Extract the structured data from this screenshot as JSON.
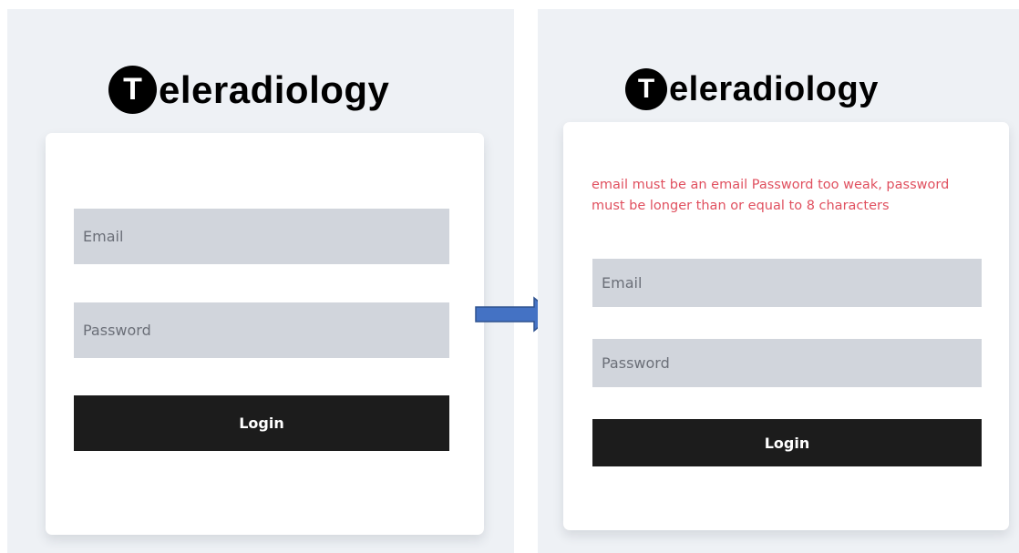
{
  "brand": {
    "initial": "T",
    "name": "eleradiology"
  },
  "before": {
    "email_placeholder": "Email",
    "password_placeholder": "Password",
    "login_label": "Login"
  },
  "after": {
    "error_message": "email must be an email Password too weak, password must be longer than or equal to 8 characters",
    "email_placeholder": "Email",
    "password_placeholder": "Password",
    "login_label": "Login"
  },
  "colors": {
    "background": "#eef1f5",
    "card": "#ffffff",
    "input": "#d1d5dc",
    "button": "#1c1c1c",
    "error": "#e0505f",
    "arrow": "#4472c4"
  },
  "icons": {
    "transition": "right-arrow-icon"
  }
}
